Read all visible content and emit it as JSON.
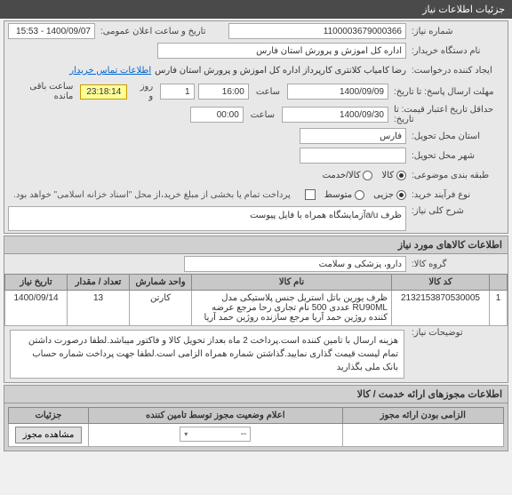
{
  "header": {
    "title": "جزئیات اطلاعات نیاز"
  },
  "form": {
    "need_no_label": "شماره نیاز:",
    "need_no": "1100003679000366",
    "announce_label": "تاریخ و ساعت اعلان عمومی:",
    "announce_value": "1400/09/07 - 15:53",
    "buyer_org_label": "نام دستگاه خریدار:",
    "buyer_org": "اداره کل اموزش و پرورش استان فارس",
    "requester_label": "ایجاد کننده درخواست:",
    "requester": "رضا کامیاب کلانتری کارپرداز اداره کل اموزش و پرورش استان فارس",
    "buyer_contact_link": "اطلاعات تماس خریدار",
    "reply_deadline_label": "مهلت ارسال پاسخ: تا تاریخ:",
    "reply_date": "1400/09/09",
    "time_label": "ساعت",
    "reply_time": "16:00",
    "days_remain": "1",
    "days_label": "روز و",
    "countdown": "23:18:14",
    "remaining_label": "ساعت باقی مانده",
    "validity_label": "حداقل تاریخ اعتبار قیمت: تا تاریخ:",
    "validity_date": "1400/09/30",
    "validity_time": "00:00",
    "delivery_state_label": "استان محل تحویل:",
    "delivery_state": "فارس",
    "delivery_city_label": "شهر محل تحویل:",
    "delivery_city": "",
    "subject_class_label": "طبقه بندی موضوعی:",
    "radio_goods": "کالا",
    "radio_service": "کالا/خدمت",
    "purchase_type_label": "نوع فرآیند خرید:",
    "radio_small": "جزیی",
    "radio_medium": "متوسط",
    "payment_note": "پرداخت تمام یا بخشی از مبلغ خرید،از محل \"اسناد خزانه اسلامی\" خواهد بود.",
    "summary_label": "شرح کلی نیاز:",
    "summary_text": "ظرف a/uآزمایشگاه همراه با فایل پیوست",
    "goods_group_label": "گروه کالا:",
    "goods_group": "دارو، پزشکی و سلامت",
    "explain_label": "توضیحات نیاز:",
    "explain_text": "هزینه ارسال با تامین کننده است.پرداخت 2 ماه بعداز تحویل کالا و فاکتور میباشد.لطفا درصورت داشتن تمام لیست قیمت گذاری نمایید.گذاشتن شماره همراه الزامی است.لطفا جهت پرداخت شماره حساب بانک ملی بگذارید"
  },
  "goods_section_title": "اطلاعات کالاهای مورد نیاز",
  "table": {
    "headers": {
      "row": "",
      "code": "کد کالا",
      "name": "نام کالا",
      "unit": "واحد شمارش",
      "qty": "تعداد / مقدار",
      "date": "تاریخ نیاز"
    },
    "rows": [
      {
        "idx": "1",
        "code": "2132153870530005",
        "name": "ظرف یورین باتل استریل جنس پلاستیکی مدل RU90ML عددی 500 نام تجاری رحا مرجع عرضه کننده روژین حمد آریا مرجع سازنده روژین حمد آریا",
        "unit": "کارتن",
        "qty": "13",
        "date": "1400/09/14"
      }
    ]
  },
  "license_section_title": "اطلاعات مجوزهای ارائه خدمت / کالا",
  "license_table": {
    "h1": "الزامی بودن ارائه مجوز",
    "h2": "اعلام وضعیت مجوز توسط تامین کننده",
    "h3": "جزئیات",
    "select_placeholder": "--",
    "btn_view": "مشاهده مجوز"
  }
}
